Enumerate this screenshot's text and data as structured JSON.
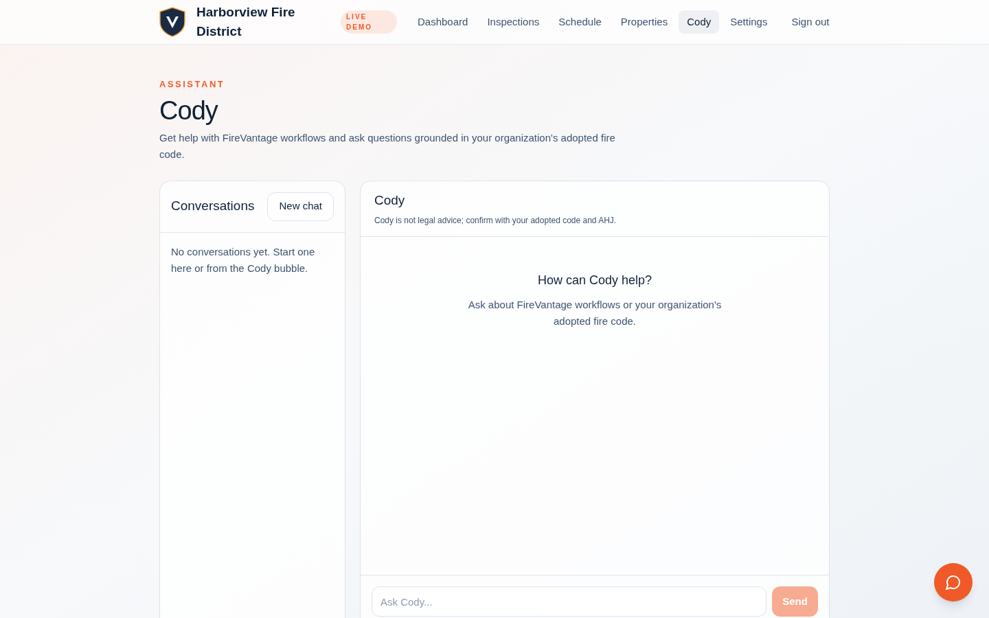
{
  "header": {
    "brand": "Harborview Fire District",
    "badge": "LIVE DEMO",
    "nav": [
      {
        "label": "Dashboard",
        "selected": false
      },
      {
        "label": "Inspections",
        "selected": false
      },
      {
        "label": "Schedule",
        "selected": false
      },
      {
        "label": "Properties",
        "selected": false
      },
      {
        "label": "Cody",
        "selected": true
      },
      {
        "label": "Settings",
        "selected": false
      }
    ],
    "sign_out": "Sign out"
  },
  "page": {
    "eyebrow": "ASSISTANT",
    "title": "Cody",
    "description": "Get help with FireVantage workflows and ask questions grounded in your organization's adopted fire code."
  },
  "conversations": {
    "title": "Conversations",
    "new_chat": "New chat",
    "empty": "No conversations yet. Start one here or from the Cody bubble."
  },
  "chat": {
    "title": "Cody",
    "disclaimer": "Cody is not legal advice; confirm with your adopted code and AHJ.",
    "empty_title": "How can Cody help?",
    "empty_text": "Ask about FireVantage workflows or your organization's adopted fire code.",
    "input": {
      "placeholder": "Ask Cody..."
    },
    "send": {
      "label": "Send",
      "disabled": true
    }
  }
}
